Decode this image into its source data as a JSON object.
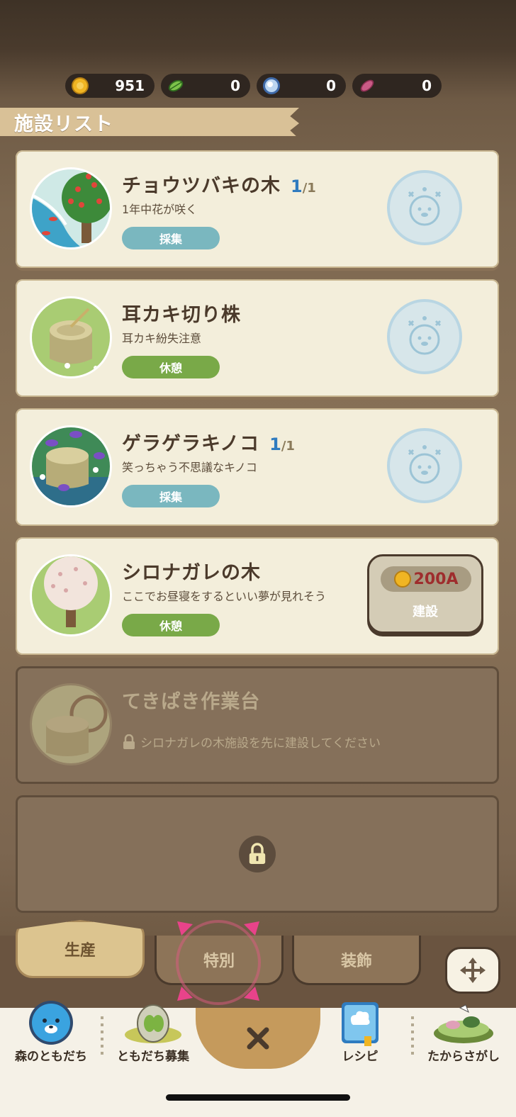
{
  "currencies": [
    {
      "icon": "gold-coin-icon",
      "value": "951",
      "color": "#f0b523"
    },
    {
      "icon": "leaf-icon",
      "value": "0",
      "color": "#6db33f"
    },
    {
      "icon": "pearl-shell-icon",
      "value": "0",
      "color": "#7aa6d6"
    },
    {
      "icon": "sweet-potato-icon",
      "value": "0",
      "color": "#b04a6e"
    }
  ],
  "header": {
    "title": "施設リスト"
  },
  "facilities": [
    {
      "title": "チョウツバキの木",
      "count": "1",
      "max": "/1",
      "desc": "1年中花が咲く",
      "status": "採集",
      "status_type": "collect",
      "thumb_icon": "camellia-tree-icon"
    },
    {
      "title": "耳カキ切り株",
      "desc": "耳カキ紛失注意",
      "status": "休憩",
      "status_type": "rest",
      "thumb_icon": "tree-stump-icon"
    },
    {
      "title": "ゲラゲラキノコ",
      "count": "1",
      "max": "/1",
      "desc": "笑っちゃう不思議なキノコ",
      "status": "採集",
      "status_type": "collect",
      "thumb_icon": "purple-mushroom-icon"
    },
    {
      "title": "シロナガレの木",
      "desc": "ここでお昼寝をするといい夢が見れそう",
      "status": "休憩",
      "status_type": "rest",
      "thumb_icon": "white-tree-icon",
      "cost": "200A",
      "build_label": "建設"
    }
  ],
  "locked_facility": {
    "title": "てきぱき作業台",
    "hint": "シロナガレの木施設を先に建設してください",
    "thumb_icon": "workbench-icon"
  },
  "tabs": {
    "production": "生産",
    "special": "特別",
    "decoration": "装飾"
  },
  "bottom_nav": {
    "forest_friends": "森のともだち",
    "recruit": "ともだち募集",
    "recipe": "レシピ",
    "treasure": "たからさがし"
  }
}
